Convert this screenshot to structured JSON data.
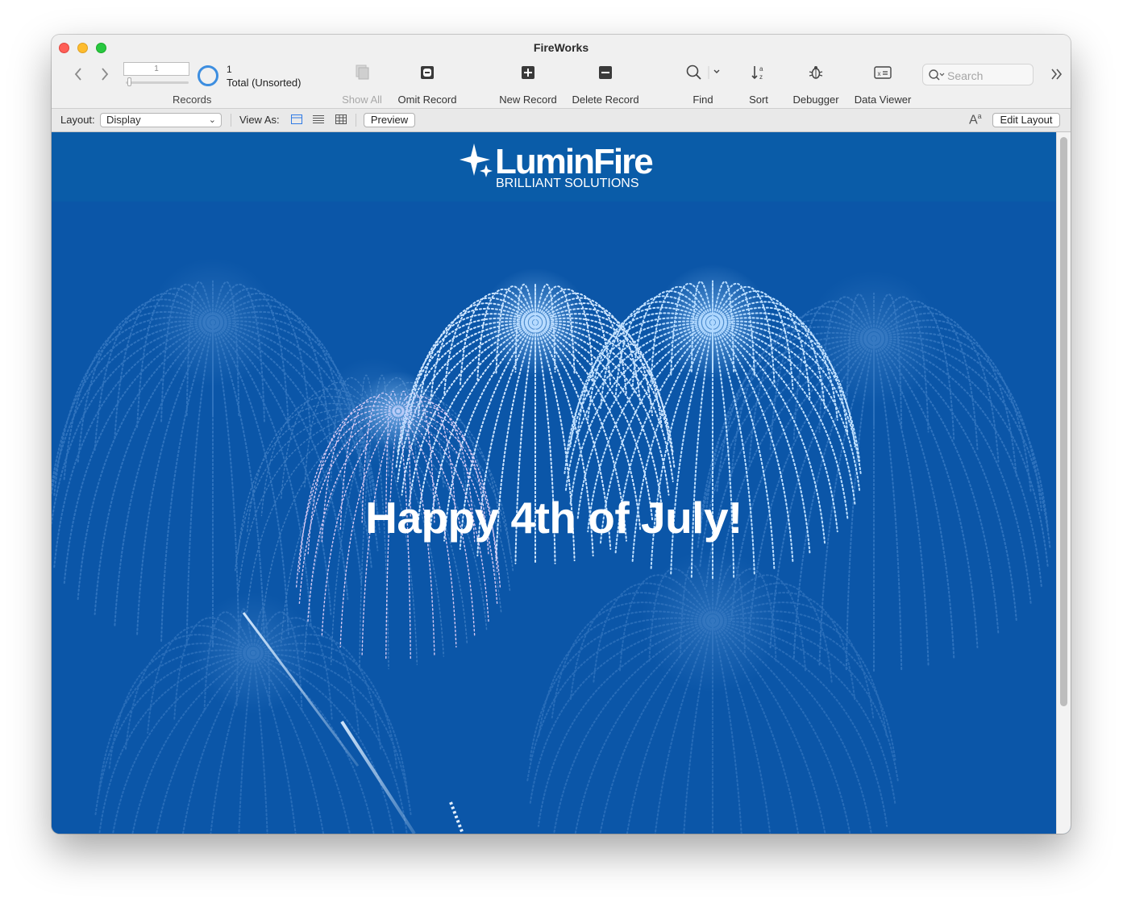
{
  "window": {
    "title": "FireWorks"
  },
  "records": {
    "current": "1",
    "count": "1",
    "total_label": "Total (Unsorted)",
    "label": "Records"
  },
  "toolbar": {
    "show_all": "Show All",
    "omit_record": "Omit Record",
    "new_record": "New Record",
    "delete_record": "Delete Record",
    "find": "Find",
    "sort": "Sort",
    "debugger": "Debugger",
    "data_viewer": "Data Viewer",
    "search_placeholder": "Search"
  },
  "layout_bar": {
    "layout_label": "Layout:",
    "layout_value": "Display",
    "view_as_label": "View As:",
    "preview_label": "Preview",
    "edit_layout_label": "Edit Layout",
    "active_view": "form"
  },
  "content": {
    "logo_name": "LuminFire",
    "logo_tagline": "BRILLIANT SOLUTIONS",
    "headline": "Happy 4th of July!",
    "background_color": "#0b56a8",
    "header_color": "#0a5ca8"
  }
}
